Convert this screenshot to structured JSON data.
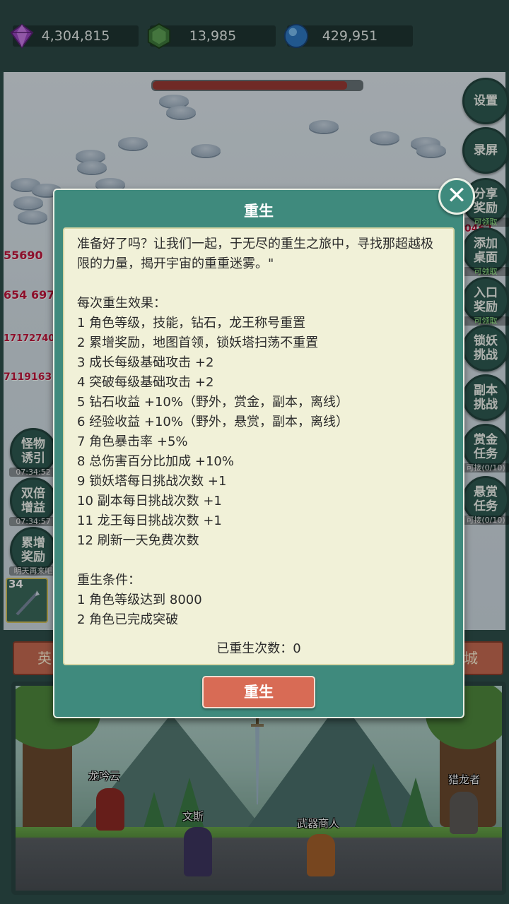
{
  "resources": [
    {
      "name": "diamond",
      "icon": "diamond-icon",
      "value": "4,304,815",
      "color": "#8a3fb0"
    },
    {
      "name": "gem",
      "icon": "green-gem-icon",
      "value": "13,985",
      "color": "#3f7a3c"
    },
    {
      "name": "orb",
      "icon": "blue-orb-icon",
      "value": "429,951",
      "color": "#3b8fd6"
    }
  ],
  "boss_hp_fraction": 0.93,
  "right_buttons": [
    {
      "label": "设置",
      "sub": ""
    },
    {
      "label": "录屏",
      "sub": ""
    },
    {
      "label": "分享\n奖励",
      "sub": "可领取"
    },
    {
      "label": "添加\n桌面",
      "sub": "可领取"
    },
    {
      "label": "入口\n奖励",
      "sub": "可领取"
    },
    {
      "label": "锁妖\n挑战",
      "sub": ""
    },
    {
      "label": "副本\n挑战",
      "sub": ""
    },
    {
      "label": "赏金\n任务",
      "sub": "可接(0/10)"
    },
    {
      "label": "悬赏\n任务",
      "sub": "可接(0/10)"
    }
  ],
  "left_buttons": [
    {
      "label": "怪物\n诱引",
      "sub": "07:34:52"
    },
    {
      "label": "双倍\n增益",
      "sub": "07:34:57"
    },
    {
      "label": "累增\n奖励",
      "sub": "明天再来吧"
    }
  ],
  "skill_level": "34",
  "tabs": {
    "left": "英",
    "right": "城"
  },
  "npcs": {
    "longyinyun": "龙吟云",
    "wensi": "文斯",
    "weapon_merchant": "武器商人",
    "dragon_hunter": "猎龙者"
  },
  "dialog": {
    "title": "重生",
    "intro": "准备好了吗？让我们一起，于无尽的重生之旅中，寻找那超越极限的力量，揭开宇宙的重重迷雾。\"",
    "effects_title": "每次重生效果：",
    "effects": [
      "1 角色等级，技能，钻石，龙王称号重置",
      "2 累增奖励，地图首领，锁妖塔扫荡不重置",
      "3 成长每级基础攻击 +2",
      "4 突破每级基础攻击 +2",
      "5 钻石收益 +10%（野外，赏金，副本，离线）",
      "6 经验收益 +10%（野外，悬赏，副本，离线）",
      "7 角色暴击率 +5%",
      "8 总伤害百分比加成 +10%",
      "9 锁妖塔每日挑战次数 +1",
      "10 副本每日挑战次数 +1",
      "11 龙王每日挑战次数 +1",
      "12 刷新一天免费次数"
    ],
    "conditions_title": "重生条件：",
    "conditions": [
      "1 角色等级达到 8000",
      "2 角色已完成突破"
    ],
    "rebirth_count": "已重生次数：0",
    "button_label": "重生",
    "close_icon": "close-icon"
  },
  "colors": {
    "dialog_bg": "#3f8a7d",
    "panel_bg": "#f1f1d8",
    "button": "#d86b55"
  }
}
